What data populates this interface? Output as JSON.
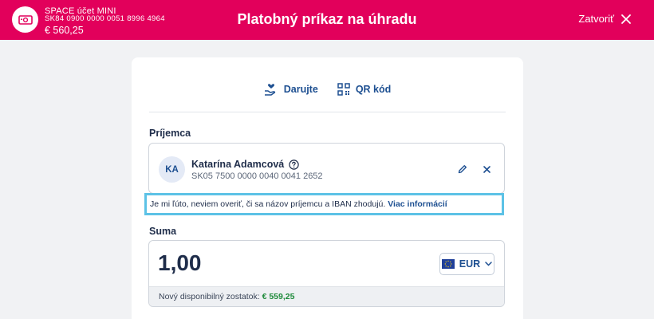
{
  "header": {
    "account_name": "SPACE účet MINI",
    "account_iban": "SK84 0900 0000 0051 8996 4964",
    "account_balance": "€ 560,25",
    "title": "Platobný príkaz na úhradu",
    "close_label": "Zatvoriť",
    "accent": "#e2005b"
  },
  "options": {
    "donate_label": "Darujte",
    "qr_label": "QR kód"
  },
  "recipient": {
    "section_label": "Príjemca",
    "initials": "KA",
    "name": "Katarína Adamcová",
    "iban": "SK05 7500 0000 0040 0041 2652"
  },
  "warning": {
    "text": "Je mi ľúto, neviem overiť, či sa názov príjemcu a IBAN zhodujú.",
    "link": "Viac informácií"
  },
  "amount": {
    "section_label": "Suma",
    "value": "1,00",
    "currency": "EUR",
    "available_label": "Nový disponibilný zostatok:",
    "available_value": "€ 559,25"
  }
}
